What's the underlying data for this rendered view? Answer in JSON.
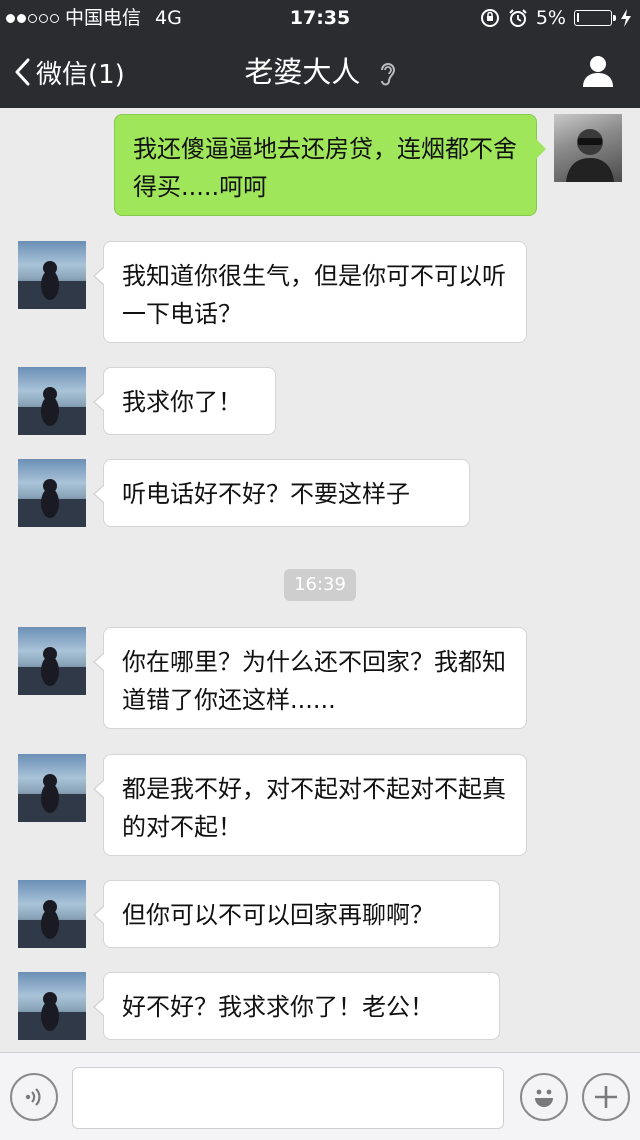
{
  "status": {
    "carrier": "中国电信",
    "network": "4G",
    "time": "17:35",
    "battery": "5%",
    "battery_level": 0.05,
    "signal_bars_filled": 2,
    "signal_bars_total": 5
  },
  "nav": {
    "back_label": "微信(1)",
    "title": "老婆大人"
  },
  "messages": [
    {
      "side": "right",
      "text": "我还傻逼逼地去还房贷，连烟都不舍得买.....呵呵"
    },
    {
      "side": "left",
      "text": "我知道你很生气，但是你可不可以听一下电话？"
    },
    {
      "side": "left",
      "text": "我求你了！"
    },
    {
      "side": "left",
      "text": "听电话好不好？不要这样子"
    },
    {
      "side": "left",
      "text": "你在哪里？为什么还不回家？我都知道错了你还这样......"
    },
    {
      "side": "left",
      "text": "都是我不好，对不起对不起对不起真的对不起！"
    },
    {
      "side": "left",
      "text": "但你可以不可以回家再聊啊？"
    },
    {
      "side": "left",
      "text": "好不好？我求求你了！老公！"
    }
  ],
  "timestamp": "16:39",
  "input": {
    "value": "",
    "placeholder": ""
  },
  "colors": {
    "header_bg": "#2b2c30",
    "chat_bg": "#ebebeb",
    "sent_bubble": "#9fe65a",
    "received_bubble": "#ffffff"
  },
  "icons": [
    "chevron-left-icon",
    "ear-icon",
    "person-icon",
    "voice-icon",
    "emoji-icon",
    "plus-icon"
  ]
}
